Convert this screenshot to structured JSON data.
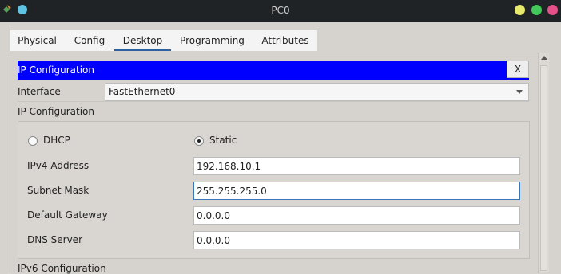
{
  "window": {
    "title": "PC0",
    "colors": {
      "min": "#e6e96a",
      "max": "#42c85a",
      "close": "#e6508a"
    }
  },
  "tabs": [
    {
      "label": "Physical"
    },
    {
      "label": "Config"
    },
    {
      "label": "Desktop",
      "active": true
    },
    {
      "label": "Programming"
    },
    {
      "label": "Attributes"
    }
  ],
  "panel": {
    "header": "IP Configuration",
    "close_label": "X",
    "header_color": "#0000ff"
  },
  "interface": {
    "label": "Interface",
    "value": "FastEthernet0"
  },
  "ip_config": {
    "title": "IP Configuration",
    "dhcp_label": "DHCP",
    "static_label": "Static",
    "selected": "Static",
    "fields": {
      "ipv4": {
        "label": "IPv4 Address",
        "value": "192.168.10.1"
      },
      "subnet": {
        "label": "Subnet Mask",
        "value": "255.255.255.0"
      },
      "gateway": {
        "label": "Default Gateway",
        "value": "0.0.0.0"
      },
      "dns": {
        "label": "DNS Server",
        "value": "0.0.0.0"
      }
    }
  },
  "ipv6_config": {
    "title": "IPv6 Configuration"
  }
}
